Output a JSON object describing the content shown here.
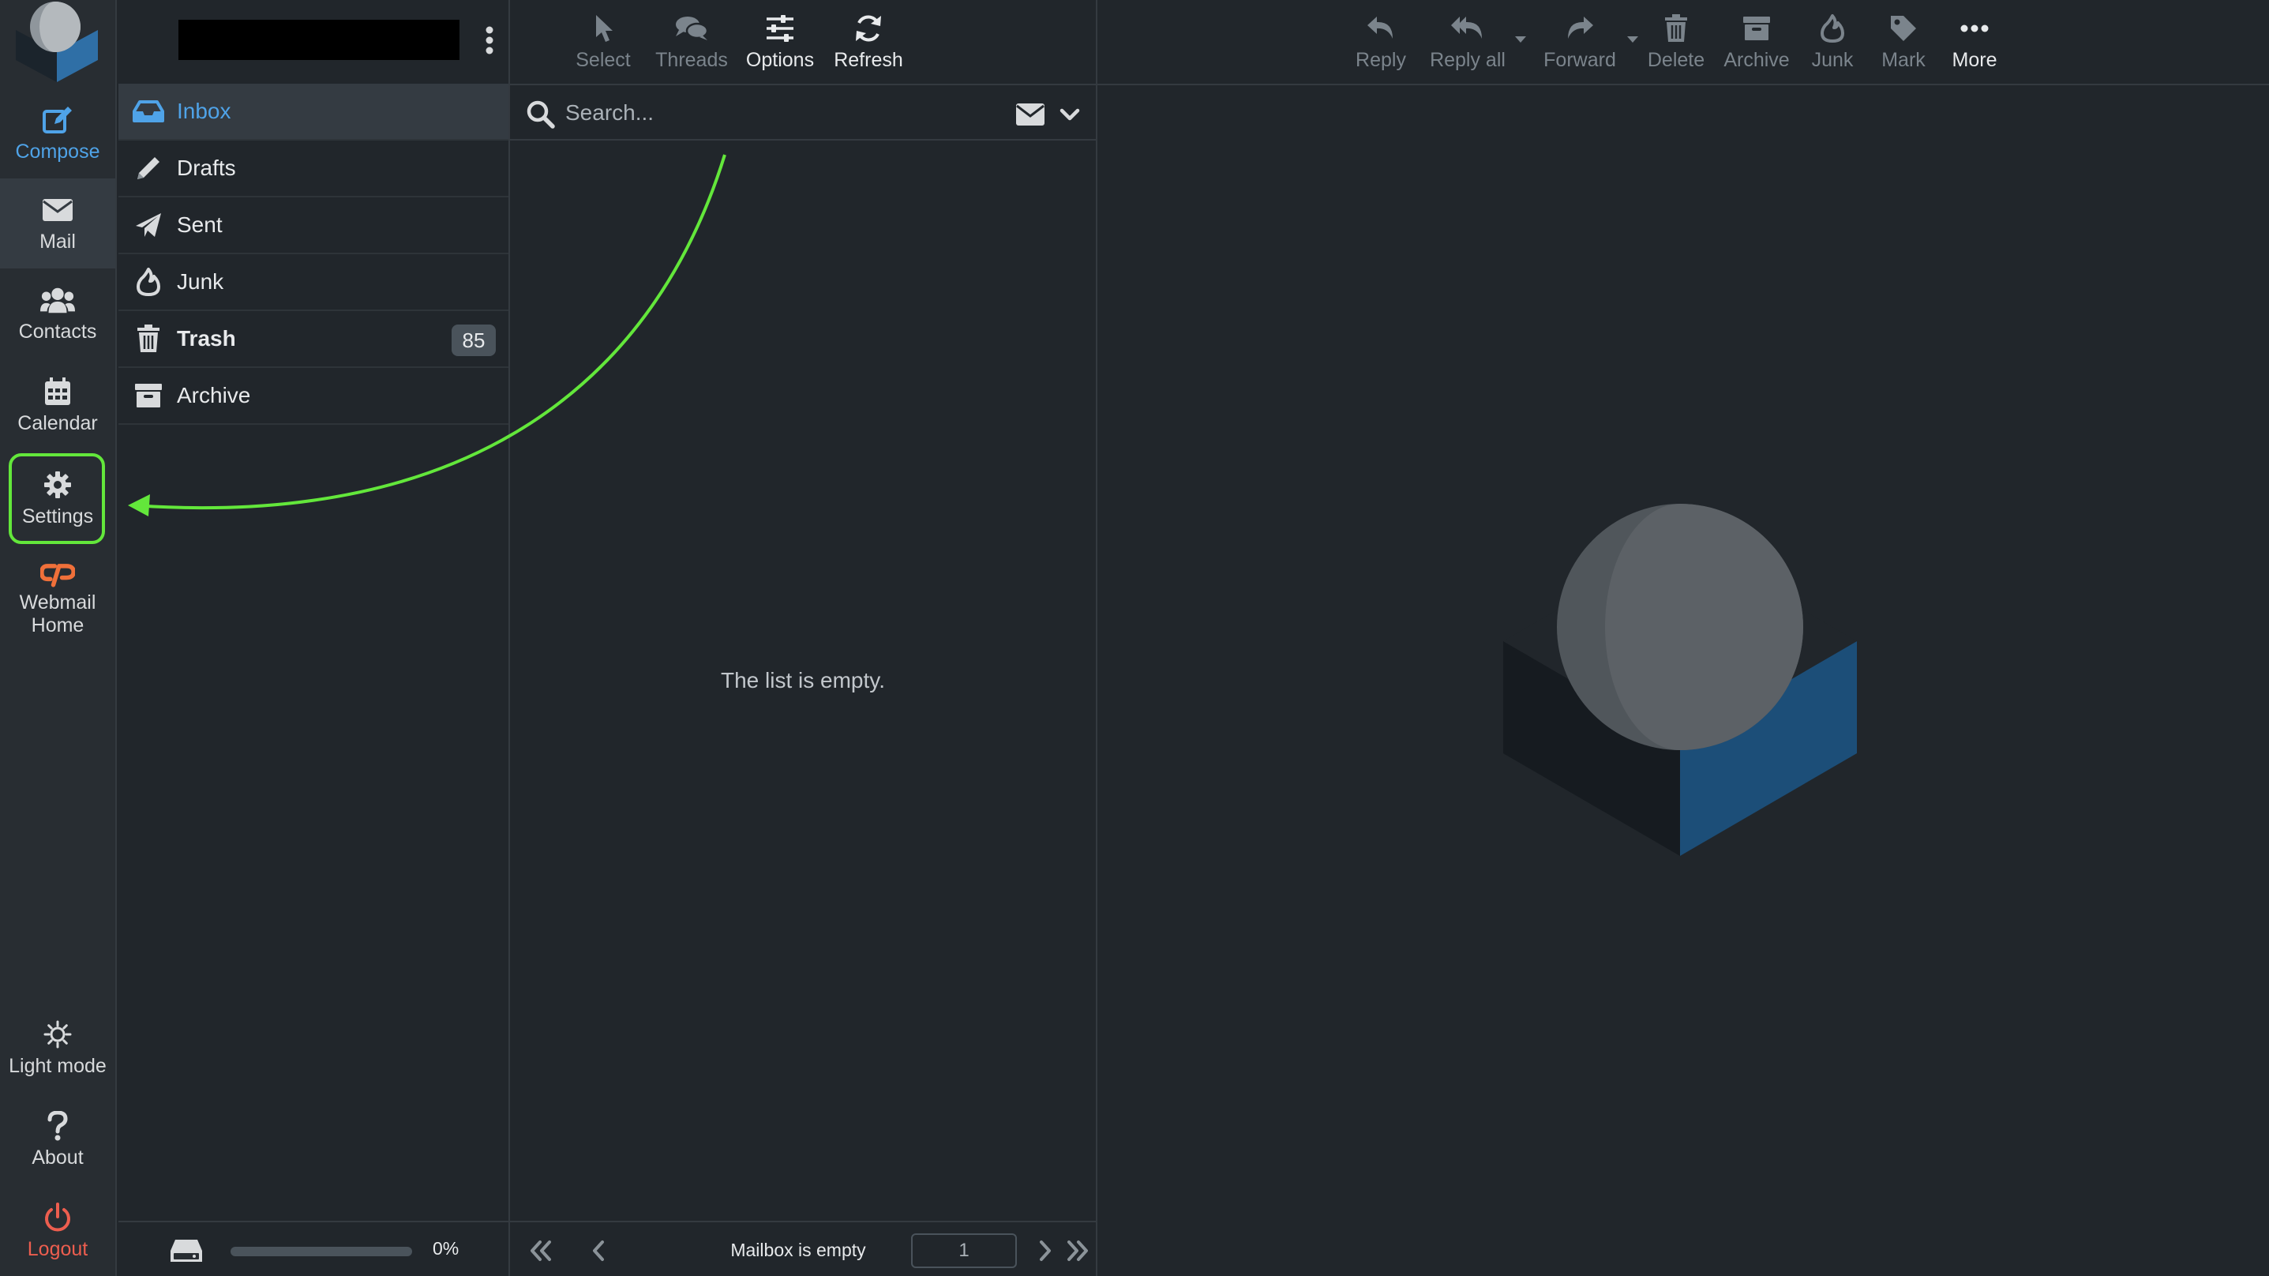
{
  "rail": {
    "compose": "Compose",
    "mail": "Mail",
    "contacts": "Contacts",
    "calendar": "Calendar",
    "settings": "Settings",
    "webmail_home": "Webmail\nHome",
    "light_mode": "Light mode",
    "about": "About",
    "logout": "Logout"
  },
  "folders": [
    {
      "label": "Inbox",
      "icon": "inbox-icon"
    },
    {
      "label": "Drafts",
      "icon": "pencil-icon"
    },
    {
      "label": "Sent",
      "icon": "paper-plane-icon"
    },
    {
      "label": "Junk",
      "icon": "fire-icon"
    },
    {
      "label": "Trash",
      "icon": "trash-icon",
      "count": "85"
    },
    {
      "label": "Archive",
      "icon": "archive-icon"
    }
  ],
  "quota": {
    "percent_label": "0%",
    "used_fraction": 0
  },
  "list_toolbar": {
    "select": "Select",
    "threads": "Threads",
    "options": "Options",
    "refresh": "Refresh"
  },
  "search": {
    "placeholder": "Search..."
  },
  "list": {
    "empty_text": "The list is empty."
  },
  "pager": {
    "status": "Mailbox is empty",
    "page": "1"
  },
  "message_toolbar": {
    "reply": "Reply",
    "reply_all": "Reply all",
    "forward": "Forward",
    "delete": "Delete",
    "archive": "Archive",
    "junk": "Junk",
    "mark": "Mark",
    "more": "More"
  },
  "colors": {
    "accent": "#4fa3e8",
    "highlight": "#63e73b",
    "logout": "#ed5e4f",
    "brand_orange": "#f0703a"
  }
}
